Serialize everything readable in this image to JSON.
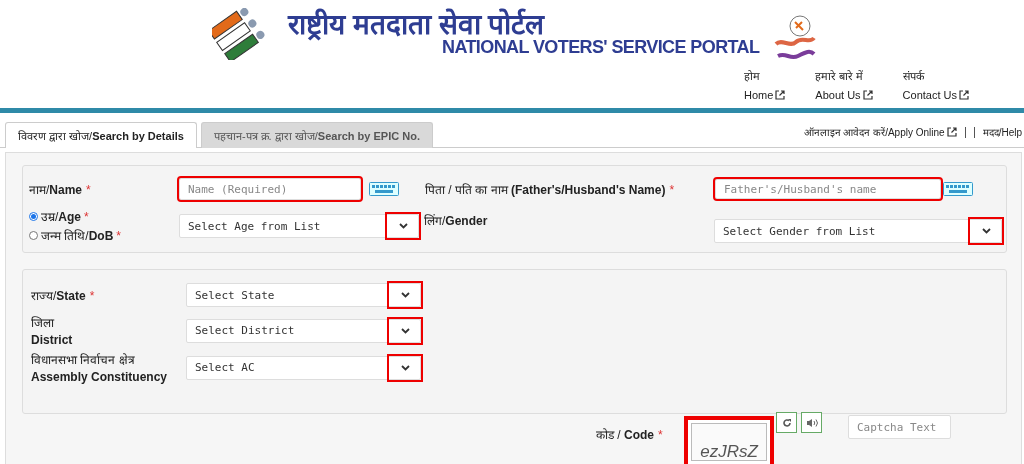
{
  "header": {
    "title_hindi": "राष्ट्रीय मतदाता सेवा पोर्टल",
    "title_english": "NATIONAL VOTERS' SERVICE PORTAL",
    "nav": [
      {
        "hindi": "होम",
        "english": "Home"
      },
      {
        "hindi": "हमारे बारे में",
        "english": "About Us"
      },
      {
        "hindi": "संपर्क",
        "english": "Contact Us"
      }
    ]
  },
  "tabs": [
    {
      "label": "विवरण द्वारा खोज/**Search by Details**",
      "selected": true
    },
    {
      "label": "पहचान-पत्र क्र. द्वारा खोज/**Search by EPIC No.**",
      "selected": false
    }
  ],
  "top_links": [
    "ऑनलाइन आवेदन करें/Apply Online",
    "मदद/Help"
  ],
  "personal": {
    "name": {
      "label": "नाम/**Name**",
      "required_mark": "*",
      "placeholder": "Name (Required)",
      "highlighted": true
    },
    "relative": {
      "label": "पिता / पति का नाम **(Father's/Husband's Name)**",
      "required_mark": "*",
      "placeholder": "Father's/Husband's name",
      "highlighted": true
    },
    "age_options": [
      {
        "label": "उम्र/**Age**",
        "required_mark": "*",
        "selected": true
      },
      {
        "label": "जन्म तिथि/**DoB**",
        "required_mark": "*",
        "selected": false
      }
    ],
    "age_select": {
      "value": "Select Age from List",
      "highlighted": true
    },
    "gender": {
      "label": "लिंग/**Gender**",
      "value": "Select Gender from List",
      "highlighted": true
    }
  },
  "location": [
    {
      "label": "राज्य/**State**",
      "required_mark": "*",
      "value": "Select State",
      "highlighted": true
    },
    {
      "label": "जिला",
      "label_english": "District",
      "value": "Select District",
      "highlighted": true
    },
    {
      "label": "विधानसभा निर्वाचन क्षेत्र",
      "label_english": "Assembly Constituency",
      "value": "Select AC",
      "highlighted": true
    }
  ],
  "captcha": {
    "label": "कोड / **Code**",
    "required_mark": "*",
    "code": "ezJRsZ",
    "placeholder": "Captcha Text",
    "highlighted": true
  }
}
